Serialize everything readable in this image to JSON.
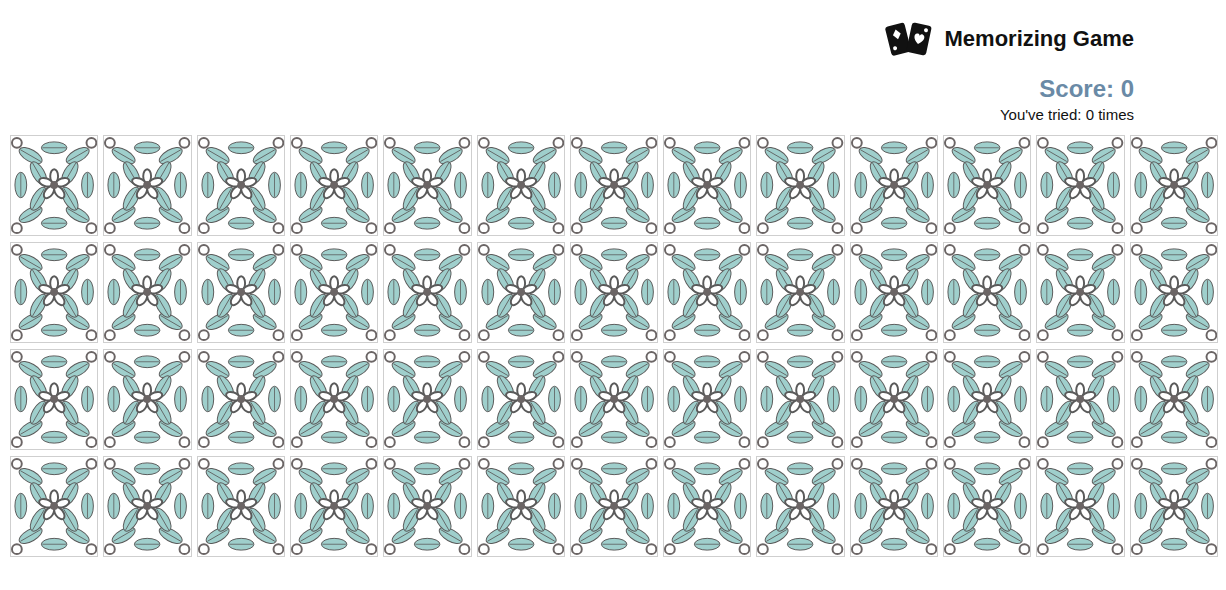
{
  "header": {
    "title": "Memorizing Game",
    "score": "Score: 0",
    "tries": "You've tried: 0 times"
  },
  "cards": [
    {
      "flipped": false
    },
    {
      "flipped": false
    },
    {
      "flipped": false
    },
    {
      "flipped": false
    },
    {
      "flipped": false
    },
    {
      "flipped": false
    },
    {
      "flipped": false
    },
    {
      "flipped": false
    },
    {
      "flipped": false
    },
    {
      "flipped": false
    },
    {
      "flipped": false
    },
    {
      "flipped": false
    },
    {
      "flipped": false
    },
    {
      "flipped": false
    },
    {
      "flipped": false
    },
    {
      "flipped": false
    },
    {
      "flipped": false
    },
    {
      "flipped": false
    },
    {
      "flipped": false
    },
    {
      "flipped": false
    },
    {
      "flipped": false
    },
    {
      "flipped": false
    },
    {
      "flipped": false
    },
    {
      "flipped": false
    },
    {
      "flipped": false
    },
    {
      "flipped": false
    },
    {
      "flipped": false
    },
    {
      "flipped": false
    },
    {
      "flipped": false
    },
    {
      "flipped": false
    },
    {
      "flipped": false
    },
    {
      "flipped": false
    },
    {
      "flipped": false
    },
    {
      "flipped": false
    },
    {
      "flipped": false
    },
    {
      "flipped": false
    },
    {
      "flipped": false
    },
    {
      "flipped": false
    },
    {
      "flipped": false
    },
    {
      "flipped": false
    },
    {
      "flipped": false
    },
    {
      "flipped": false
    },
    {
      "flipped": false
    },
    {
      "flipped": false
    },
    {
      "flipped": false
    },
    {
      "flipped": false
    },
    {
      "flipped": false
    },
    {
      "flipped": false
    },
    {
      "flipped": false
    },
    {
      "flipped": false
    },
    {
      "flipped": false
    },
    {
      "flipped": false
    }
  ]
}
